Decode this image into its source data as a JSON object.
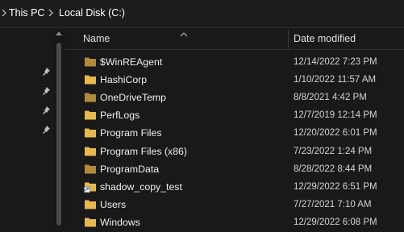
{
  "breadcrumb": {
    "items": [
      {
        "label": "This PC"
      },
      {
        "label": "Local Disk (C:)"
      }
    ]
  },
  "columns": {
    "name": "Name",
    "date_modified": "Date modified"
  },
  "files": [
    {
      "name": "$WinREAgent",
      "date": "12/14/2022 7:23 PM",
      "type": "folder-dim"
    },
    {
      "name": "HashiCorp",
      "date": "1/10/2022 11:57 AM",
      "type": "folder"
    },
    {
      "name": "OneDriveTemp",
      "date": "8/8/2021 4:42 PM",
      "type": "folder-dim"
    },
    {
      "name": "PerfLogs",
      "date": "12/7/2019 12:14 PM",
      "type": "folder"
    },
    {
      "name": "Program Files",
      "date": "12/20/2022 6:01 PM",
      "type": "folder"
    },
    {
      "name": "Program Files (x86)",
      "date": "7/23/2022 1:24 PM",
      "type": "folder"
    },
    {
      "name": "ProgramData",
      "date": "8/28/2022 8:44 PM",
      "type": "folder-dim"
    },
    {
      "name": "shadow_copy_test",
      "date": "12/29/2022 6:51 PM",
      "type": "folder-shortcut"
    },
    {
      "name": "Users",
      "date": "7/27/2021 7:10 AM",
      "type": "folder"
    },
    {
      "name": "Windows",
      "date": "12/29/2022 6:08 PM",
      "type": "folder"
    }
  ],
  "icons": {
    "breadcrumb_separator": "chevron-right-icon",
    "sort_indicator": "chevron-up-icon",
    "quick_access_pin": "pin-icon",
    "folder": "folder-icon"
  },
  "colors": {
    "folder": "#e8b84a",
    "folder_dim": "#b38a36",
    "background": "#191919"
  }
}
